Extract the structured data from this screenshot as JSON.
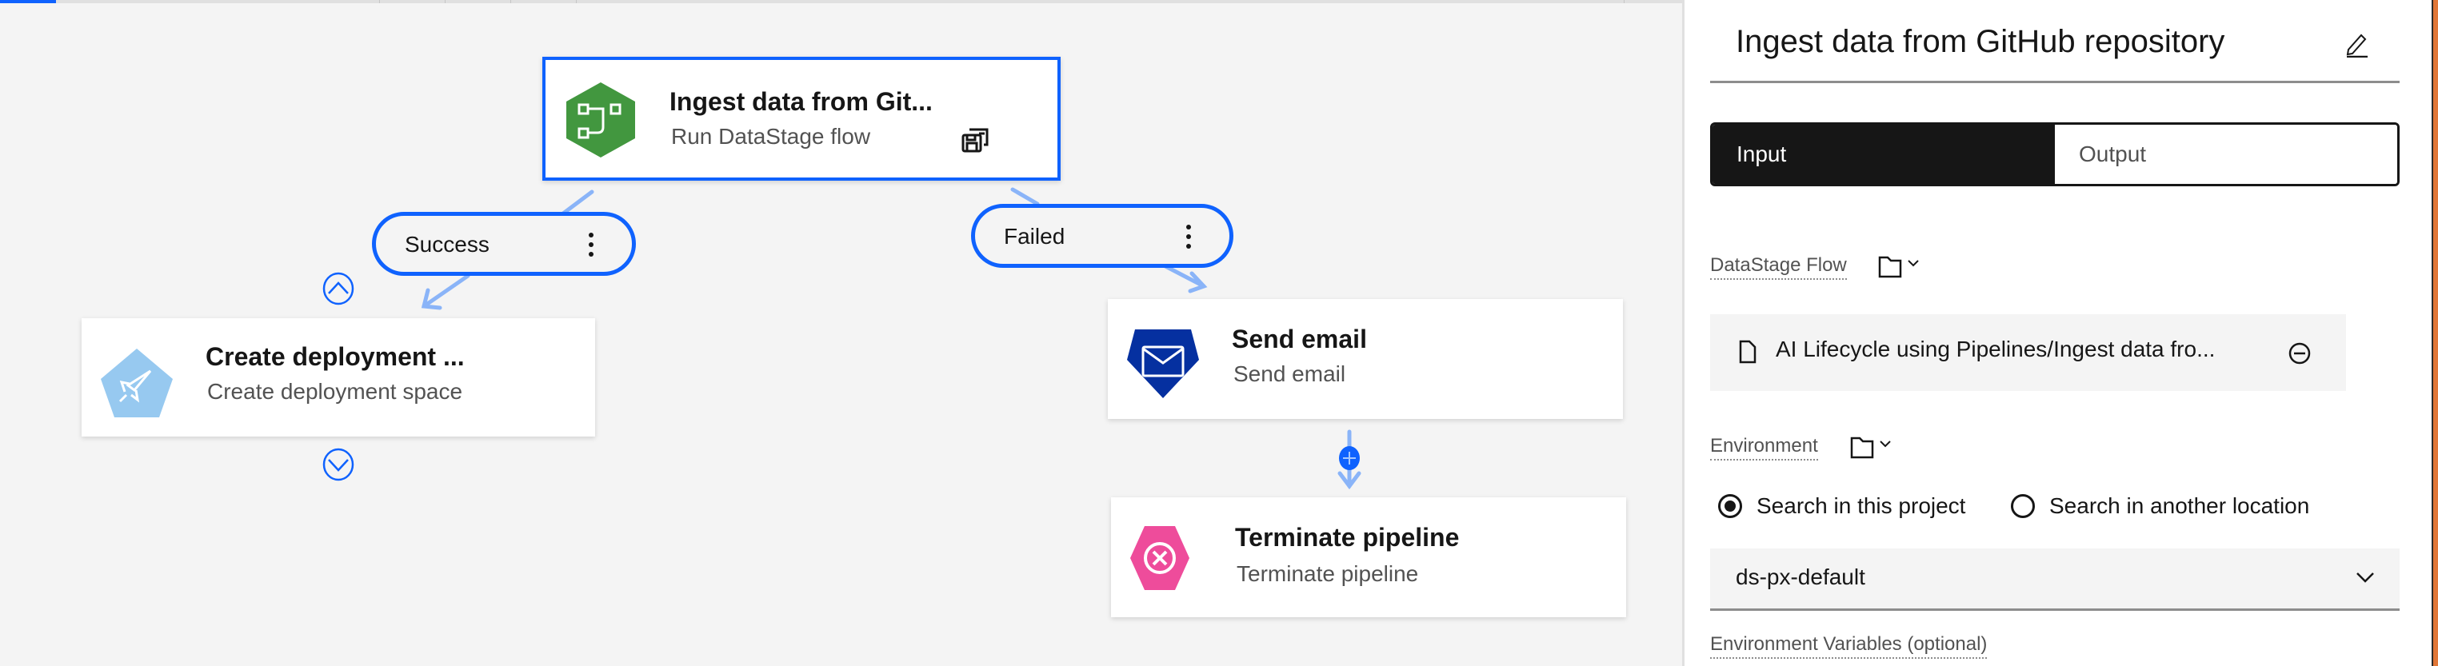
{
  "canvas": {
    "nodes": [
      {
        "id": "ingest",
        "title": "Ingest data from Git...",
        "subtitle": "Run DataStage flow",
        "icon": "datastage-flow-icon",
        "icon_color": "#42973f",
        "selected": true
      },
      {
        "id": "create-deployment",
        "title": "Create deployment ...",
        "subtitle": "Create deployment space",
        "icon": "rocket-icon",
        "icon_color": "#97c9f0"
      },
      {
        "id": "send-email",
        "title": "Send email",
        "subtitle": "Send email",
        "icon": "email-icon",
        "icon_color": "#0530a0"
      },
      {
        "id": "terminate",
        "title": "Terminate pipeline",
        "subtitle": "Terminate pipeline",
        "icon": "terminate-icon",
        "icon_color": "#ee4c9b"
      }
    ],
    "links": [
      {
        "label": "Success",
        "from": "ingest",
        "to": "create-deployment"
      },
      {
        "label": "Failed",
        "from": "ingest",
        "to": "send-email"
      },
      {
        "label": "",
        "from": "send-email",
        "to": "terminate"
      }
    ],
    "accent_color": "#0f62fe",
    "link_color": "#8ab4f8"
  },
  "panel": {
    "title": "Ingest data from GitHub repository",
    "tabs": [
      {
        "label": "Input",
        "active": true
      },
      {
        "label": "Output",
        "active": false
      }
    ],
    "datastage_flow": {
      "label": "DataStage Flow",
      "value": "AI Lifecycle using Pipelines/Ingest data fro..."
    },
    "environment": {
      "label": "Environment",
      "radios": [
        {
          "label": "Search in this project",
          "checked": true
        },
        {
          "label": "Search in another location",
          "checked": false
        }
      ],
      "selected": "ds-px-default"
    },
    "env_vars_label": "Environment Variables (optional)"
  }
}
